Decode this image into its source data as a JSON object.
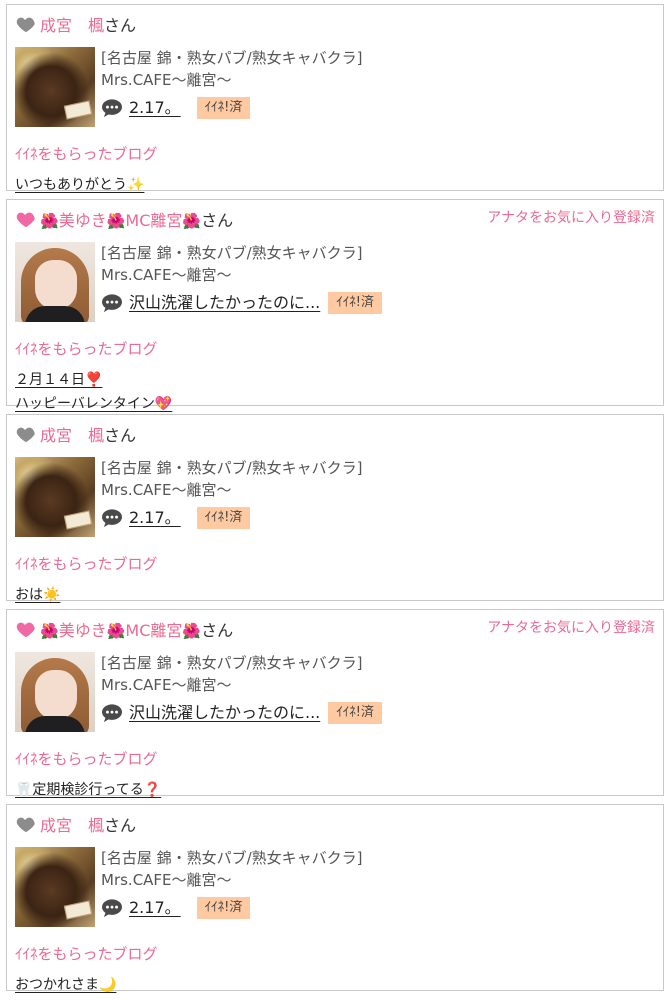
{
  "cards": [
    {
      "heart_color": "#8c8c8c",
      "name": "成宮　楓",
      "san": "さん",
      "favorite": "",
      "thumb": "cake",
      "category": "[名古屋 錦・熟女パブ/熟女キャバクラ]",
      "shop": "Mrs.CAFE〜離宮〜",
      "blog_title": "2.17。",
      "iine": "ｲｲﾈ!済",
      "section_label": "ｲｲﾈをもらったブログ",
      "items": [
        "いつもありがとう✨"
      ]
    },
    {
      "heart_color": "#f068a4",
      "name_parts": [
        "🌺",
        "美ゆき",
        "🌺",
        "MC離宮",
        "🌺"
      ],
      "san": "さん",
      "favorite": "アナタをお気に入り登録済",
      "thumb": "face",
      "category": "[名古屋 錦・熟女パブ/熟女キャバクラ]",
      "shop": "Mrs.CAFE〜離宮〜",
      "blog_title": "沢山洗濯したかったのに...",
      "iine": "ｲｲﾈ!済",
      "section_label": "ｲｲﾈをもらったブログ",
      "items": [
        "２月１４日❣️",
        "ハッピーバレンタイン💖"
      ]
    },
    {
      "heart_color": "#8c8c8c",
      "name": "成宮　楓",
      "san": "さん",
      "favorite": "",
      "thumb": "cake",
      "category": "[名古屋 錦・熟女パブ/熟女キャバクラ]",
      "shop": "Mrs.CAFE〜離宮〜",
      "blog_title": "2.17。",
      "iine": "ｲｲﾈ!済",
      "section_label": "ｲｲﾈをもらったブログ",
      "items": [
        "おは☀️"
      ]
    },
    {
      "heart_color": "#f068a4",
      "name_parts": [
        "🌺",
        "美ゆき",
        "🌺",
        "MC離宮",
        "🌺"
      ],
      "san": "さん",
      "favorite": "アナタをお気に入り登録済",
      "thumb": "face",
      "category": "[名古屋 錦・熟女パブ/熟女キャバクラ]",
      "shop": "Mrs.CAFE〜離宮〜",
      "blog_title": "沢山洗濯したかったのに...",
      "iine": "ｲｲﾈ!済",
      "section_label": "ｲｲﾈをもらったブログ",
      "items": [
        "🦷定期検診行ってる❓"
      ]
    },
    {
      "heart_color": "#8c8c8c",
      "name": "成宮　楓",
      "san": "さん",
      "favorite": "",
      "thumb": "cake",
      "category": "[名古屋 錦・熟女パブ/熟女キャバクラ]",
      "shop": "Mrs.CAFE〜離宮〜",
      "blog_title": "2.17。",
      "iine": "ｲｲﾈ!済",
      "section_label": "ｲｲﾈをもらったブログ",
      "items": [
        "おつかれさま🌙"
      ]
    }
  ]
}
